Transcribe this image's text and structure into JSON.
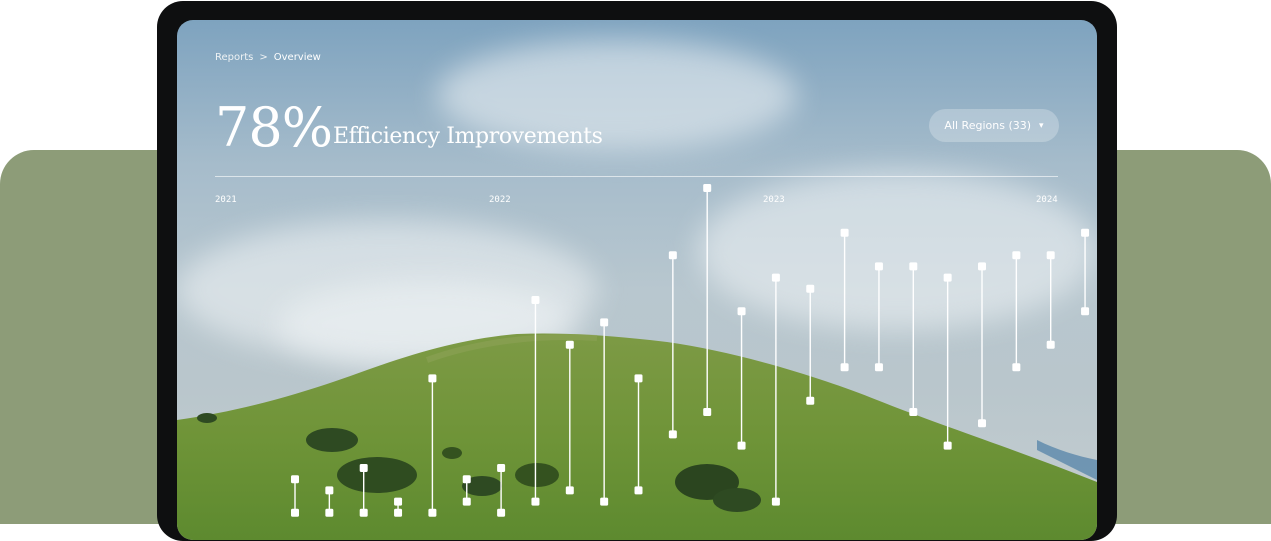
{
  "breadcrumb": {
    "parent": "Reports",
    "separator": ">",
    "current": "Overview"
  },
  "header": {
    "metric_value": "78%",
    "metric_label": "Efficiency Improvements"
  },
  "region_filter": {
    "label": "All Regions (33)",
    "icon": "caret-down-icon",
    "caret": "▾"
  },
  "timeline": {
    "years": [
      "2021",
      "2022",
      "2023",
      "2024"
    ]
  },
  "chart_data": {
    "type": "range-bar",
    "x": [
      1,
      2,
      3,
      4,
      5,
      6,
      7,
      8,
      9,
      10,
      11,
      12,
      13,
      14,
      15,
      16,
      17,
      18,
      19,
      20,
      21,
      22,
      23,
      24
    ],
    "low": [
      1,
      1,
      1,
      1,
      1,
      2,
      1,
      2,
      3,
      2,
      3,
      8,
      10,
      7,
      2,
      11,
      14,
      14,
      10,
      7,
      9,
      14,
      16,
      19
    ],
    "high": [
      4,
      3,
      5,
      2,
      13,
      4,
      5,
      20,
      16,
      18,
      13,
      24,
      30,
      19,
      22,
      21,
      26,
      23,
      23,
      22,
      23,
      24,
      24,
      26
    ],
    "color": "#ffffff"
  },
  "colors": {
    "sage": "#8d9c78",
    "bezel": "#0e0f10",
    "text": "#ffffff"
  }
}
